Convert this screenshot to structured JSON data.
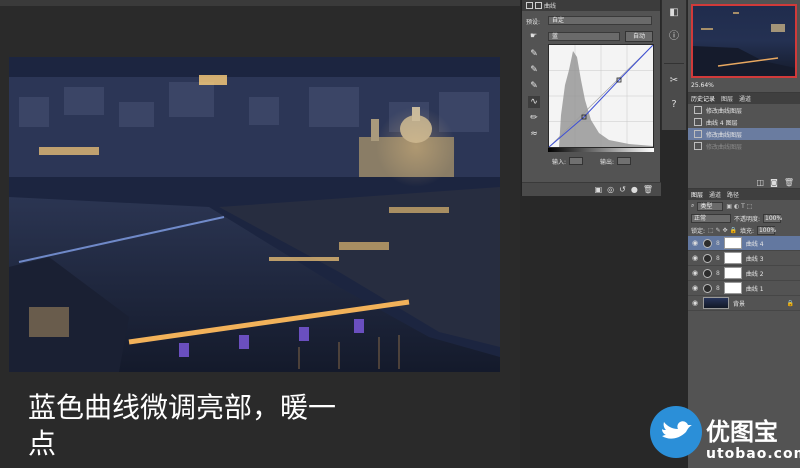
{
  "caption": {
    "line1": "蓝色曲线微调亮部，暖一",
    "line2": "点"
  },
  "curves_panel": {
    "tabs": [
      "曲线"
    ],
    "preset_label": "预设:",
    "preset_value": "自定",
    "channel_value": "蓝",
    "auto_label": "自动",
    "input_label": "输入:",
    "output_label": "输出:"
  },
  "navigator": {
    "zoom": "25.64%"
  },
  "history": {
    "tabs": [
      "历史记录",
      "图层",
      "通道"
    ],
    "items": [
      {
        "label": "修改曲线图层",
        "state": "normal"
      },
      {
        "label": "曲线 4 图层",
        "state": "normal"
      },
      {
        "label": "修改曲线图层",
        "state": "selected"
      },
      {
        "label": "修改曲线图层",
        "state": "dim"
      }
    ]
  },
  "layers": {
    "tabs": [
      "图层",
      "通道",
      "路径"
    ],
    "kind_label": "类型",
    "blend_mode": "正常",
    "opacity_label": "不透明度:",
    "opacity_value": "100%",
    "lock_label": "锁定:",
    "fill_label": "填充:",
    "fill_value": "100%",
    "rows": [
      {
        "name": "曲线 4",
        "type": "adjustment",
        "selected": true
      },
      {
        "name": "曲线 3",
        "type": "adjustment",
        "selected": false
      },
      {
        "name": "曲线 2",
        "type": "adjustment",
        "selected": false
      },
      {
        "name": "曲线 1",
        "type": "adjustment",
        "selected": false
      },
      {
        "name": "背景",
        "type": "image",
        "selected": false
      }
    ]
  },
  "watermark": {
    "cn": "优图宝",
    "en": "utobao.com"
  },
  "colors": {
    "selection": "#6378a0",
    "curve": "#3d4fd6",
    "brand_blue": "#2b8fd8"
  }
}
